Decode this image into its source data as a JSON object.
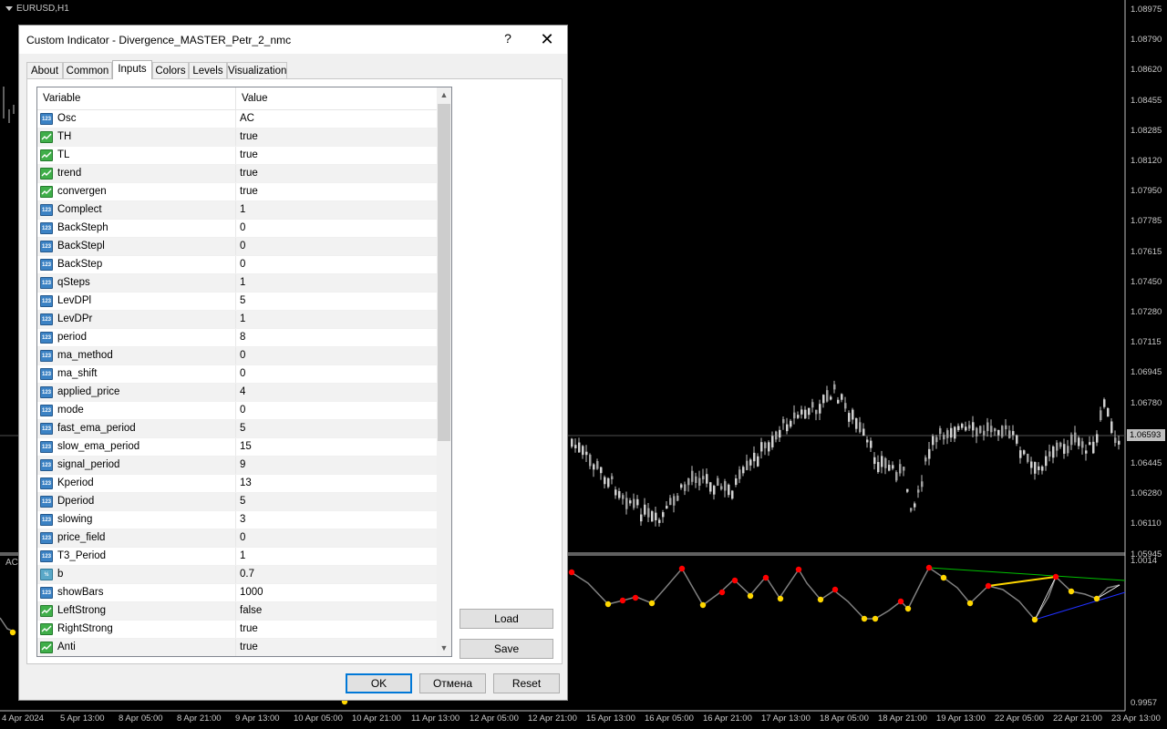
{
  "chart": {
    "symbol_title": "EURUSD,H1",
    "indicator_label": "AC",
    "price_levels": [
      "1.08975",
      "1.08790",
      "1.08620",
      "1.08455",
      "1.08285",
      "1.08120",
      "1.07950",
      "1.07785",
      "1.07615",
      "1.07450",
      "1.07280",
      "1.07115",
      "1.06945",
      "1.06780",
      "1.06610",
      "1.06445",
      "1.06280",
      "1.06110",
      "1.05945"
    ],
    "current_price": "1.06593",
    "indicator_levels": [
      "1.0014",
      "0.9957"
    ],
    "time_labels": [
      "4 Apr 2024",
      "5 Apr 13:00",
      "8 Apr 05:00",
      "8 Apr 21:00",
      "9 Apr 13:00",
      "10 Apr 05:00",
      "10 Apr 21:00",
      "11 Apr 13:00",
      "12 Apr 05:00",
      "12 Apr 21:00",
      "15 Apr 13:00",
      "16 Apr 05:00",
      "16 Apr 21:00",
      "17 Apr 13:00",
      "18 Apr 05:00",
      "18 Apr 21:00",
      "19 Apr 13:00",
      "22 Apr 05:00",
      "22 Apr 21:00",
      "23 Apr 13:00"
    ],
    "colors": {
      "background": "#000000",
      "candle": "#c0c0c0",
      "osc_line": "#808080",
      "peak": "#ff0000",
      "trough": "#ffd700",
      "trend_green": "#00c000",
      "trend_yellow": "#ffd700",
      "trend_blue": "#2030ff"
    }
  },
  "dialog": {
    "title": "Custom Indicator - Divergence_MASTER_Petr_2_nmc",
    "help": "?",
    "close": "✕",
    "tabs": [
      "About",
      "Common",
      "Inputs",
      "Colors",
      "Levels",
      "Visualization"
    ],
    "active_tab": "Inputs",
    "columns": {
      "variable": "Variable",
      "value": "Value"
    },
    "params": [
      {
        "type": "num",
        "name": "Osc",
        "value": "AC"
      },
      {
        "type": "bool",
        "name": "TH",
        "value": "true"
      },
      {
        "type": "bool",
        "name": "TL",
        "value": "true"
      },
      {
        "type": "bool",
        "name": "trend",
        "value": "true"
      },
      {
        "type": "bool",
        "name": "convergen",
        "value": "true"
      },
      {
        "type": "num",
        "name": "Complect",
        "value": "1"
      },
      {
        "type": "num",
        "name": "BackSteph",
        "value": "0"
      },
      {
        "type": "num",
        "name": "BackStepl",
        "value": "0"
      },
      {
        "type": "num",
        "name": "BackStep",
        "value": "0"
      },
      {
        "type": "num",
        "name": "qSteps",
        "value": "1"
      },
      {
        "type": "num",
        "name": "LevDPl",
        "value": "5"
      },
      {
        "type": "num",
        "name": "LevDPr",
        "value": "1"
      },
      {
        "type": "num",
        "name": "period",
        "value": "8"
      },
      {
        "type": "num",
        "name": "ma_method",
        "value": "0"
      },
      {
        "type": "num",
        "name": "ma_shift",
        "value": "0"
      },
      {
        "type": "num",
        "name": "applied_price",
        "value": "4"
      },
      {
        "type": "num",
        "name": "mode",
        "value": "0"
      },
      {
        "type": "num",
        "name": "fast_ema_period",
        "value": "5"
      },
      {
        "type": "num",
        "name": "slow_ema_period",
        "value": "15"
      },
      {
        "type": "num",
        "name": "signal_period",
        "value": "9"
      },
      {
        "type": "num",
        "name": "Kperiod",
        "value": "13"
      },
      {
        "type": "num",
        "name": "Dperiod",
        "value": "5"
      },
      {
        "type": "num",
        "name": "slowing",
        "value": "3"
      },
      {
        "type": "num",
        "name": "price_field",
        "value": "0"
      },
      {
        "type": "num",
        "name": "T3_Period",
        "value": "1"
      },
      {
        "type": "dbl",
        "name": "b",
        "value": "0.7"
      },
      {
        "type": "num",
        "name": "showBars",
        "value": "1000"
      },
      {
        "type": "bool",
        "name": "LeftStrong",
        "value": "false"
      },
      {
        "type": "bool",
        "name": "RightStrong",
        "value": "true"
      },
      {
        "type": "bool",
        "name": "Anti",
        "value": "true"
      }
    ],
    "buttons": {
      "load": "Load",
      "save": "Save",
      "ok": "OK",
      "cancel": "Отмена",
      "reset": "Reset"
    }
  }
}
